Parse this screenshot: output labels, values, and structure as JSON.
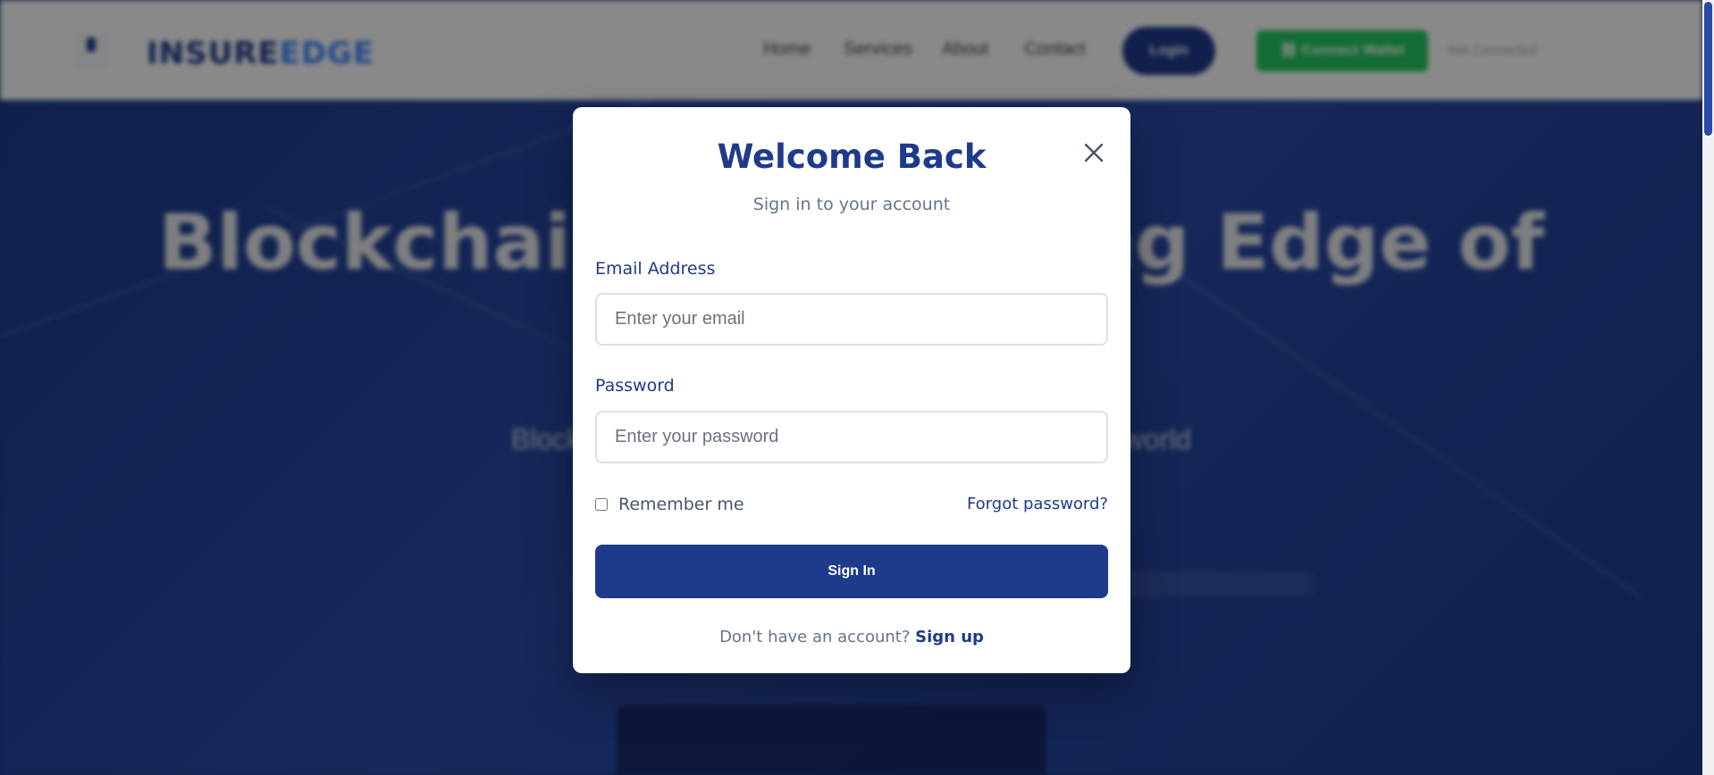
{
  "background": {
    "brand": {
      "part1": "INSURE",
      "part2": "EDGE"
    },
    "nav": [
      "Home",
      "Services",
      "About",
      "Contact"
    ],
    "login_label": "Login",
    "connect_label": "⛓ Connect Wallet",
    "status_text": "Not Connected",
    "hero_title": "Blockchain: The Cutting Edge of",
    "hero_subtitle": "Blockchain technology transforming the modern world"
  },
  "modal": {
    "title": "Welcome Back",
    "subtitle": "Sign in to your account",
    "email": {
      "label": "Email Address",
      "placeholder": "Enter your email",
      "value": ""
    },
    "password": {
      "label": "Password",
      "placeholder": "Enter your password",
      "value": ""
    },
    "remember_label": "Remember me",
    "remember_checked": false,
    "forgot_label": "Forgot password?",
    "signin_label": "Sign In",
    "signup_prompt": "Don't have an account?",
    "signup_label": "Sign up"
  },
  "colors": {
    "primary": "#1e3a8a",
    "accent_green": "#22c55e",
    "muted_text": "#64748b"
  },
  "icons": {
    "close": "close-icon"
  }
}
